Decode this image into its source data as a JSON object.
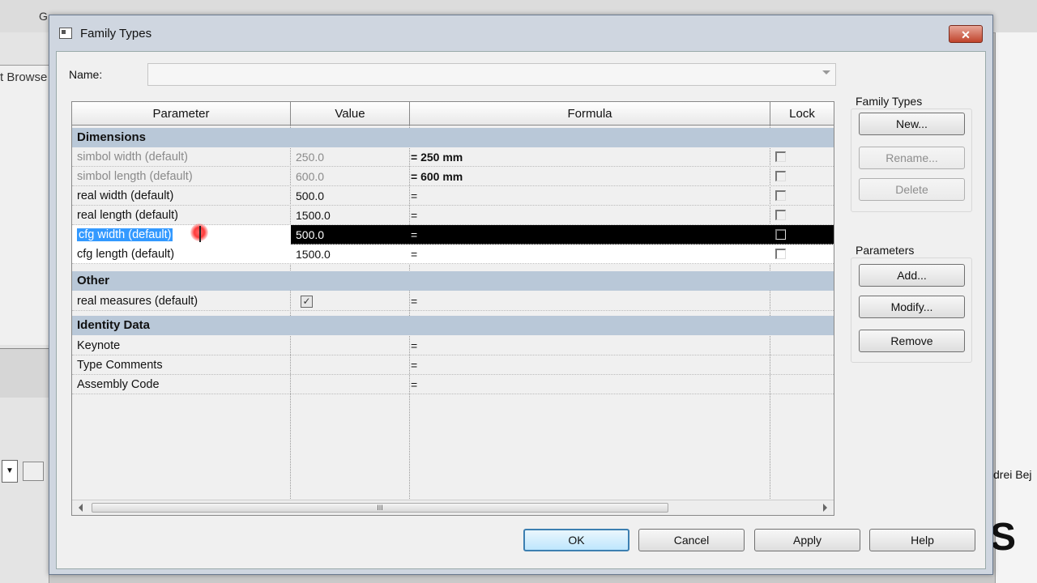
{
  "background": {
    "top_fragment": "G",
    "left_fragment": "t Browse",
    "right_name_fragment": "drei Bej",
    "right_big_fragment": "S"
  },
  "dialog": {
    "title": "Family Types",
    "close_symbol": "✕",
    "name_label": "Name:",
    "name_value": ""
  },
  "grid": {
    "headers": {
      "parameter": "Parameter",
      "value": "Value",
      "formula": "Formula",
      "lock": "Lock"
    },
    "groups": {
      "dimensions": "Dimensions",
      "other": "Other",
      "identity": "Identity Data"
    },
    "dimensions_rows": [
      {
        "parameter": "simbol width (default)",
        "value": "250.0",
        "formula": "= 250 mm"
      },
      {
        "parameter": "simbol length (default)",
        "value": "600.0",
        "formula": "= 600 mm"
      },
      {
        "parameter": "real width (default)",
        "value": "500.0",
        "formula": "="
      },
      {
        "parameter": "real length (default)",
        "value": "1500.0",
        "formula": "="
      },
      {
        "parameter": "cfg width (default)",
        "value": "500.0",
        "formula": "="
      },
      {
        "parameter": "cfg length (default)",
        "value": "1500.0",
        "formula": "="
      }
    ],
    "other_rows": [
      {
        "parameter": "real measures (default)",
        "checked": true,
        "check_symbol": "✓",
        "formula": "="
      }
    ],
    "identity_rows": [
      {
        "parameter": "Keynote",
        "formula": "="
      },
      {
        "parameter": "Type Comments",
        "formula": "="
      },
      {
        "parameter": "Assembly Code",
        "formula": "="
      }
    ],
    "scroll_grip": "III"
  },
  "family_types_panel": {
    "label": "Family Types",
    "new": "New...",
    "rename": "Rename...",
    "delete": "Delete"
  },
  "parameters_panel": {
    "label": "Parameters",
    "add": "Add...",
    "modify": "Modify...",
    "remove": "Remove"
  },
  "footer": {
    "ok": "OK",
    "cancel": "Cancel",
    "apply": "Apply",
    "help": "Help"
  }
}
